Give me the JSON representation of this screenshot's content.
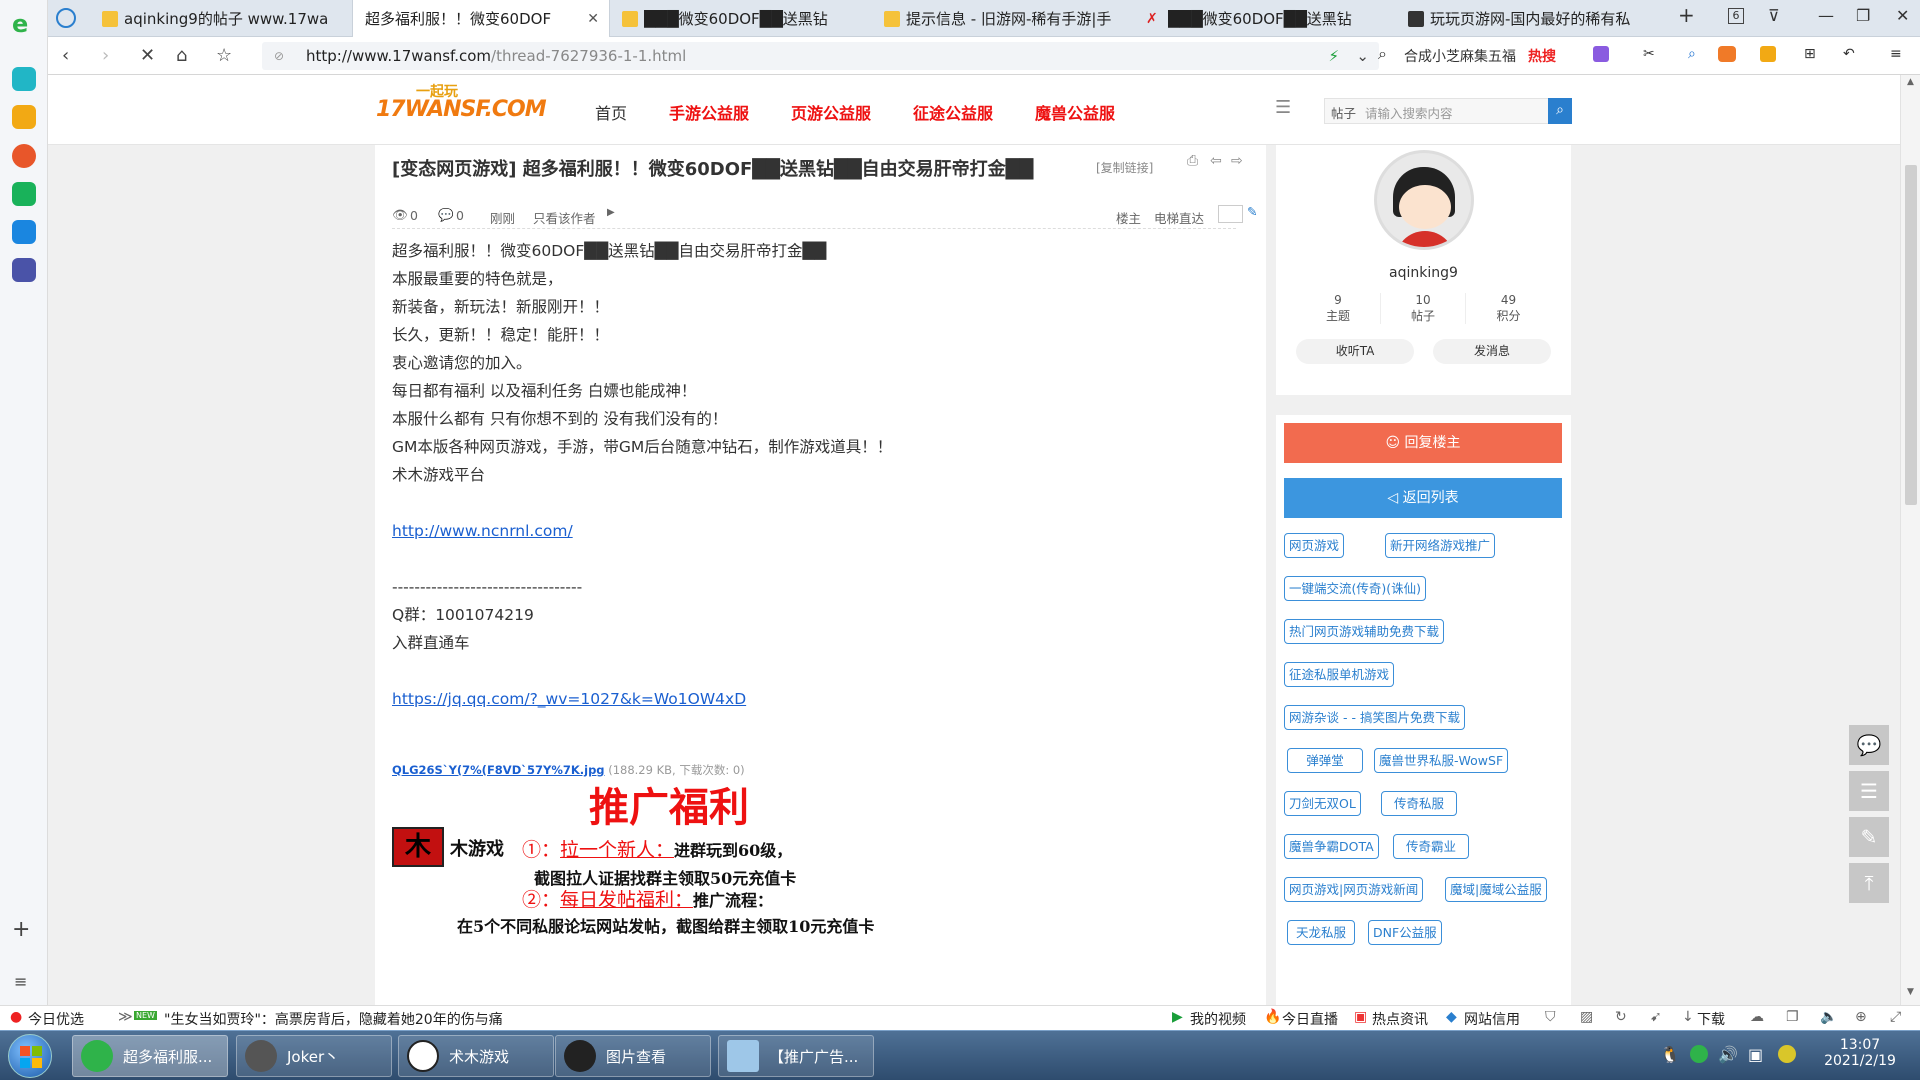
{
  "browser": {
    "tabs": [
      {
        "title": "aqinking9的帖子 www.17wa",
        "active": false
      },
      {
        "title": "超多福利服！！微变60DOF",
        "active": true
      },
      {
        "title": "███微变60DOF██送黑钻",
        "active": false
      },
      {
        "title": "提示信息 - 旧游网-稀有手游|手",
        "active": false
      },
      {
        "title": "███微变60DOF██送黑钻",
        "active": false
      },
      {
        "title": "玩玩页游网-国内最好的稀有私",
        "active": false
      }
    ],
    "tab_count": "6",
    "url_host": "http://www.17wansf.com",
    "url_path": "/thread-7627936-1-1.html",
    "search_text": "合成小芝麻集五福",
    "hot_label": "热搜"
  },
  "site": {
    "logo_text": "17WANSF.COM",
    "logo_top": "一起玩",
    "nav": [
      "首页",
      "手游公益服",
      "页游公益服",
      "征途公益服",
      "魔兽公益服"
    ],
    "search_category": "帖子",
    "search_placeholder": "请输入搜索内容"
  },
  "post": {
    "title": "[变态网页游戏] 超多福利服！！微变60DOF██送黑钻██自由交易肝帝打金██",
    "copy_link": "[复制链接]",
    "views": "0",
    "replies": "0",
    "time": "刚刚",
    "only_author": "只看该作者",
    "floor": "楼主",
    "elevator": "电梯直达",
    "lines": [
      "超多福利服！！微变60DOF██送黑钻██自由交易肝帝打金██",
      "",
      "本服最重要的特色就是，",
      "新装备，新玩法！新服刚开！！",
      "长久，更新！！稳定！能肝！！",
      "衷心邀请您的加入。",
      "每日都有福利 以及福利任务 白嫖也能成神！",
      "本服什么都有 只有你想不到的 没有我们没有的！",
      "",
      "GM本版各种网页游戏，手游，带GM后台随意冲钻石，制作游戏道具！！",
      "术木游戏平台"
    ],
    "link1": "http://www.ncnrnl.com/",
    "divider": "----------------------------------",
    "qq_group": "Q群：1001074219",
    "join_text": "入群直通车",
    "link2": "https://jq.qq.com/?_wv=1027&k=Wo1OW4xD",
    "attachment_name": "QLG26S`Y(7%(F8VD`57Y%7K.jpg",
    "attachment_meta": "(188.29 KB, 下载次数: 0)",
    "promo": {
      "title": "推广福利",
      "brand": "木游戏",
      "item1_num": "①：",
      "item1_head": "拉一个新人：",
      "item1_tail": "进群玩到60级，",
      "item1_sub": "截图拉人证据找群主领取50元充值卡",
      "item2_num": "②：",
      "item2_head": "每日发帖福利：",
      "item2_tail": "推广流程：",
      "item2_sub": "在5个不同私服论坛网站发帖，截图给群主领取10元充值卡"
    }
  },
  "author": {
    "name": "aqinking9",
    "stats": [
      {
        "value": "9",
        "label": "主题"
      },
      {
        "value": "10",
        "label": "帖子"
      },
      {
        "value": "49",
        "label": "积分"
      }
    ],
    "follow": "收听TA",
    "message": "发消息"
  },
  "actions": {
    "reply": "回复楼主",
    "back": "返回列表"
  },
  "tags": [
    [
      "网页游戏",
      "新开网络游戏推广"
    ],
    [
      "一键端交流(传奇)(诛仙)"
    ],
    [
      "热门网页游戏辅助免费下载"
    ],
    [
      "征途私服单机游戏"
    ],
    [
      "网游杂谈 - - 搞笑图片免费下载"
    ],
    [
      "弹弹堂",
      "魔兽世界私服-WowSF"
    ],
    [
      "刀剑无双OL",
      "传奇私服"
    ],
    [
      "魔兽争霸DOTA",
      "传奇霸业"
    ],
    [
      "网页游戏|网页游戏新闻",
      "魔域|魔域公益服"
    ],
    [
      "天龙私服",
      "DNF公益服"
    ]
  ],
  "statusbar": {
    "left": "今日优选",
    "new_badge": "NEW",
    "news": "\"生女当如贾玲\"：高票房背后，隐藏着她20年的伤与痛",
    "items": [
      "我的视频",
      "今日直播",
      "热点资讯",
      "网站信用"
    ],
    "download": "下载"
  },
  "taskbar": {
    "tasks": [
      "超多福利服...",
      "Joker丶",
      "术木游戏",
      "图片查看",
      "【推广广告..."
    ],
    "time": "13:07",
    "date": "2021/2/19"
  },
  "colors": {
    "nav_red": "#e11111",
    "reply_btn": "#f26b4f",
    "back_btn": "#3c96df",
    "tag_blue": "#2a7fce"
  }
}
